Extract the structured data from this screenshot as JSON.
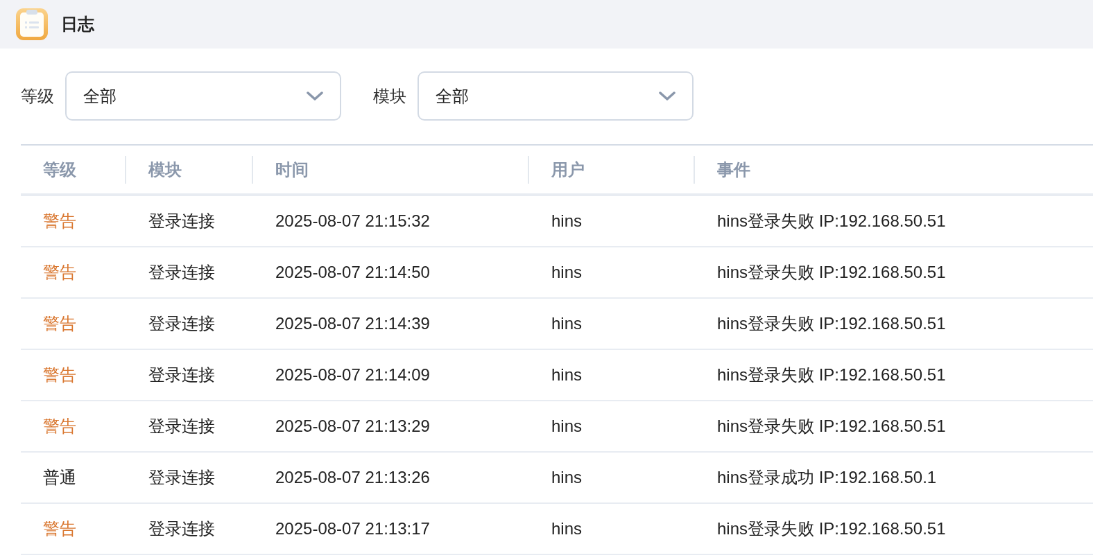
{
  "header": {
    "title": "日志"
  },
  "filters": [
    {
      "label": "等级",
      "value": "全部"
    },
    {
      "label": "模块",
      "value": "全部"
    }
  ],
  "table": {
    "columns": [
      "等级",
      "模块",
      "时间",
      "用户",
      "事件"
    ],
    "rows": [
      {
        "kind": "warning",
        "cells": [
          "警告",
          "登录连接",
          "2025-08-07 21:15:32",
          "hins",
          "hins登录失败 IP:192.168.50.51"
        ]
      },
      {
        "kind": "warning",
        "cells": [
          "警告",
          "登录连接",
          "2025-08-07 21:14:50",
          "hins",
          "hins登录失败 IP:192.168.50.51"
        ]
      },
      {
        "kind": "warning",
        "cells": [
          "警告",
          "登录连接",
          "2025-08-07 21:14:39",
          "hins",
          "hins登录失败 IP:192.168.50.51"
        ]
      },
      {
        "kind": "warning",
        "cells": [
          "警告",
          "登录连接",
          "2025-08-07 21:14:09",
          "hins",
          "hins登录失败 IP:192.168.50.51"
        ]
      },
      {
        "kind": "warning",
        "cells": [
          "警告",
          "登录连接",
          "2025-08-07 21:13:29",
          "hins",
          "hins登录失败 IP:192.168.50.51"
        ]
      },
      {
        "kind": "normal",
        "cells": [
          "普通",
          "登录连接",
          "2025-08-07 21:13:26",
          "hins",
          "hins登录成功 IP:192.168.50.1"
        ]
      },
      {
        "kind": "warning",
        "cells": [
          "警告",
          "登录连接",
          "2025-08-07 21:13:17",
          "hins",
          "hins登录失败 IP:192.168.50.51"
        ]
      }
    ]
  }
}
